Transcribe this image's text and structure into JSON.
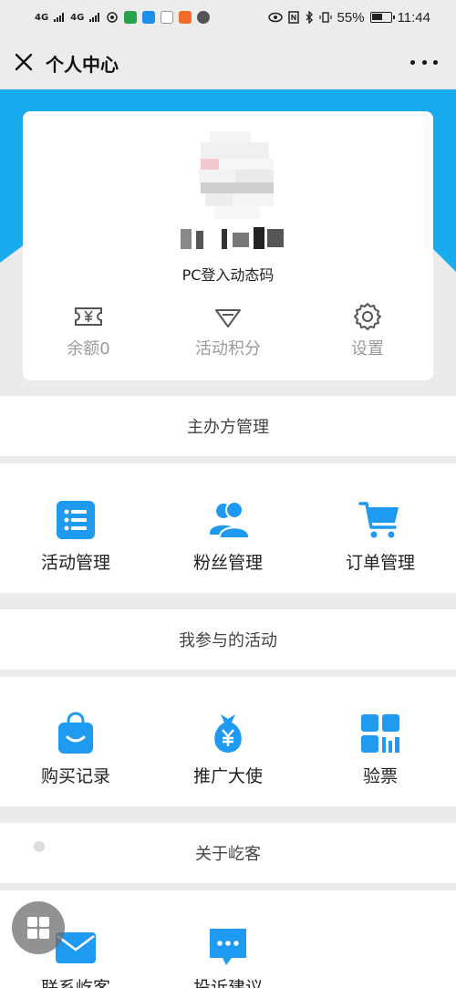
{
  "status_bar": {
    "signal1": "4G",
    "signal2": "4G",
    "battery": "55%",
    "time": "11:44"
  },
  "title_bar": {
    "title": "个人中心",
    "close_icon": "close-icon",
    "more_icon": "more-icon"
  },
  "profile": {
    "pc_code": "PC登入动态码",
    "stats": [
      {
        "label": "余额0",
        "icon": "ticket-yen-icon"
      },
      {
        "label": "活动积分",
        "icon": "diamond-icon"
      },
      {
        "label": "设置",
        "icon": "gear-icon"
      }
    ]
  },
  "sections": {
    "organizer": {
      "title": "主办方管理",
      "items": [
        {
          "label": "活动管理",
          "icon": "list-icon"
        },
        {
          "label": "粉丝管理",
          "icon": "users-icon"
        },
        {
          "label": "订单管理",
          "icon": "cart-icon"
        }
      ]
    },
    "participated": {
      "title": "我参与的活动",
      "items": [
        {
          "label": "购买记录",
          "icon": "shopping-bag-icon"
        },
        {
          "label": "推广大使",
          "icon": "money-bag-icon"
        },
        {
          "label": "验票",
          "icon": "qr-scan-icon"
        }
      ]
    },
    "about": {
      "title": "关于屹客",
      "items": [
        {
          "label": "联系屹客",
          "icon": "mail-icon"
        },
        {
          "label": "投诉建议",
          "icon": "chat-icon"
        }
      ]
    }
  },
  "colors": {
    "accent": "#1aabef",
    "icon_blue": "#1e9bf0",
    "background": "#ebebeb"
  }
}
